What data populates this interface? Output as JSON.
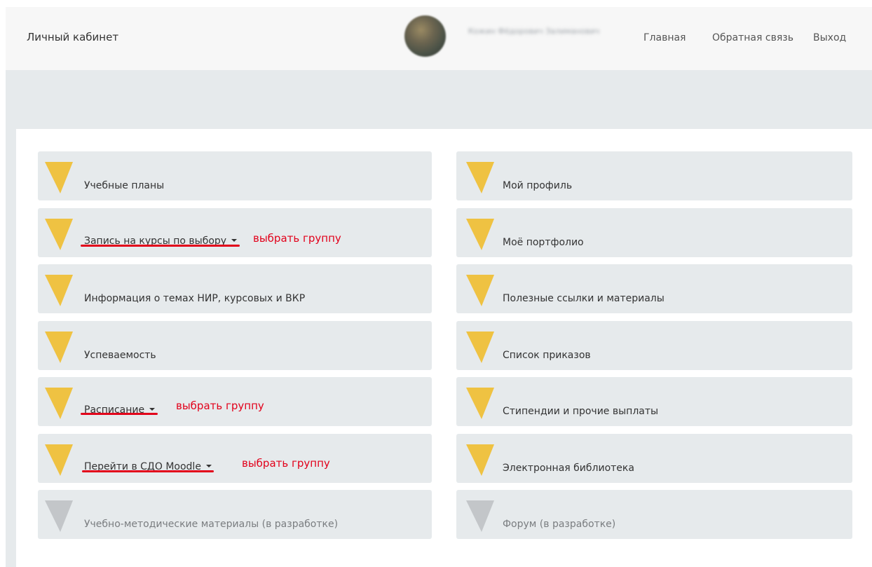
{
  "header": {
    "brand": "Личный кабинет",
    "username": "Кожин Фёдорович Залиманович",
    "nav": [
      "Главная",
      "Обратная связь",
      "Выход"
    ]
  },
  "left_cards": [
    {
      "label": "Учебные планы"
    },
    {
      "label": "Запись на курсы по выбору"
    },
    {
      "label": "Информация о темах НИР, курсовых и ВКР"
    },
    {
      "label": "Успеваемость"
    },
    {
      "label": "Расписание"
    },
    {
      "label": "Перейти в СДО Moodle"
    },
    {
      "label": "Учебно-методические материалы (в разработке)"
    }
  ],
  "right_cards": [
    {
      "label": "Мой профиль"
    },
    {
      "label": "Моё портфолио"
    },
    {
      "label": "Полезные ссылки и материалы"
    },
    {
      "label": "Список приказов"
    },
    {
      "label": "Стипендии и прочие выплаты"
    },
    {
      "label": "Электронная библиотека"
    },
    {
      "label": "Форум (в разработке)"
    }
  ],
  "annotations": {
    "courses": "выбрать группу",
    "schedule": "выбрать группу",
    "moodle": "выбрать группу"
  },
  "colors": {
    "accent_triangle": "#efc242",
    "disabled_triangle": "#c3c6c9",
    "annotation_red": "#e2001a"
  }
}
